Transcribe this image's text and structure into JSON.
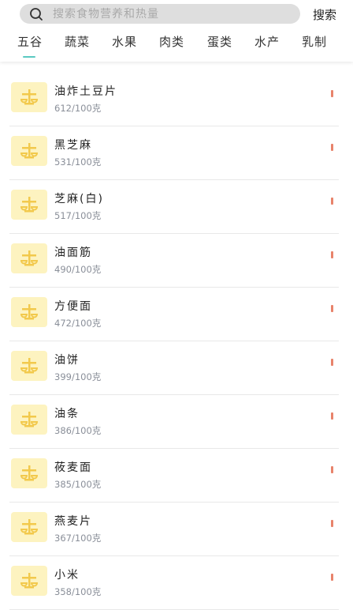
{
  "search": {
    "placeholder": "搜索食物营养和热量",
    "button_label": "搜索"
  },
  "tabs": [
    {
      "label": "五谷",
      "active": true
    },
    {
      "label": "蔬菜"
    },
    {
      "label": "水果"
    },
    {
      "label": "肉类"
    },
    {
      "label": "蛋类"
    },
    {
      "label": "水产"
    },
    {
      "label": "乳制"
    }
  ],
  "colors": {
    "accent": "#5bc9c1",
    "thumb_bg": "#fdf3c0",
    "icon": "#f2c94c",
    "marker": "#e8836b"
  },
  "foods": [
    {
      "name": "油炸土豆片",
      "calories": "612/100克"
    },
    {
      "name": "黑芝麻",
      "calories": "531/100克"
    },
    {
      "name": "芝麻(白)",
      "calories": "517/100克"
    },
    {
      "name": "油面筋",
      "calories": "490/100克"
    },
    {
      "name": "方便面",
      "calories": "472/100克"
    },
    {
      "name": "油饼",
      "calories": "399/100克"
    },
    {
      "name": "油条",
      "calories": "386/100克"
    },
    {
      "name": "莜麦面",
      "calories": "385/100克"
    },
    {
      "name": "燕麦片",
      "calories": "367/100克"
    },
    {
      "name": "小米",
      "calories": "358/100克"
    }
  ]
}
